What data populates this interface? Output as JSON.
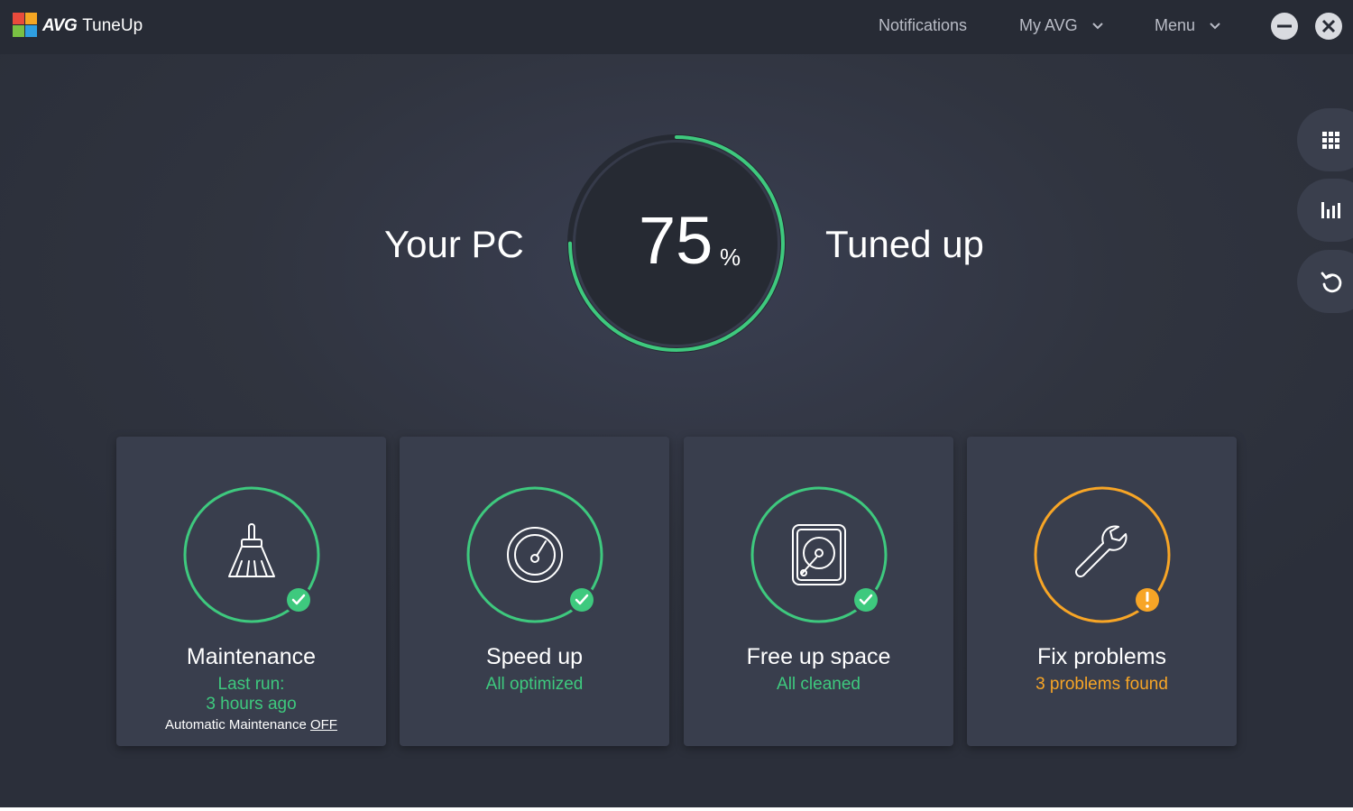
{
  "app": {
    "brand_prefix": "AVG",
    "brand_name": "TuneUp"
  },
  "nav": {
    "notifications": "Notifications",
    "my_avg": "My AVG",
    "menu": "Menu"
  },
  "hero": {
    "left_text": "Your PC",
    "right_text": "Tuned up",
    "score_value": "75",
    "score_unit": "%",
    "score_fraction": 0.75
  },
  "cards": [
    {
      "title": "Maintenance",
      "subtitle_line1": "Last run:",
      "subtitle_line2": "3 hours ago",
      "footer_text": "Automatic Maintenance",
      "footer_link": "OFF",
      "status": "ok"
    },
    {
      "title": "Speed up",
      "subtitle_line1": "All optimized",
      "status": "ok"
    },
    {
      "title": "Free up space",
      "subtitle_line1": "All cleaned",
      "status": "ok"
    },
    {
      "title": "Fix problems",
      "subtitle_line1": "3 problems found",
      "status": "warning"
    }
  ],
  "icons": {
    "logo": "avg-logo-icon",
    "maintenance": "broom-icon",
    "speed": "speedometer-icon",
    "space": "hard-drive-icon",
    "fix": "wrench-icon",
    "side_1": "grid-icon",
    "side_2": "bar-chart-icon",
    "side_3": "undo-icon"
  },
  "colors": {
    "ok": "#3ec97e",
    "warning": "#f7a526",
    "background": "#30343f",
    "card": "#393e4d"
  }
}
